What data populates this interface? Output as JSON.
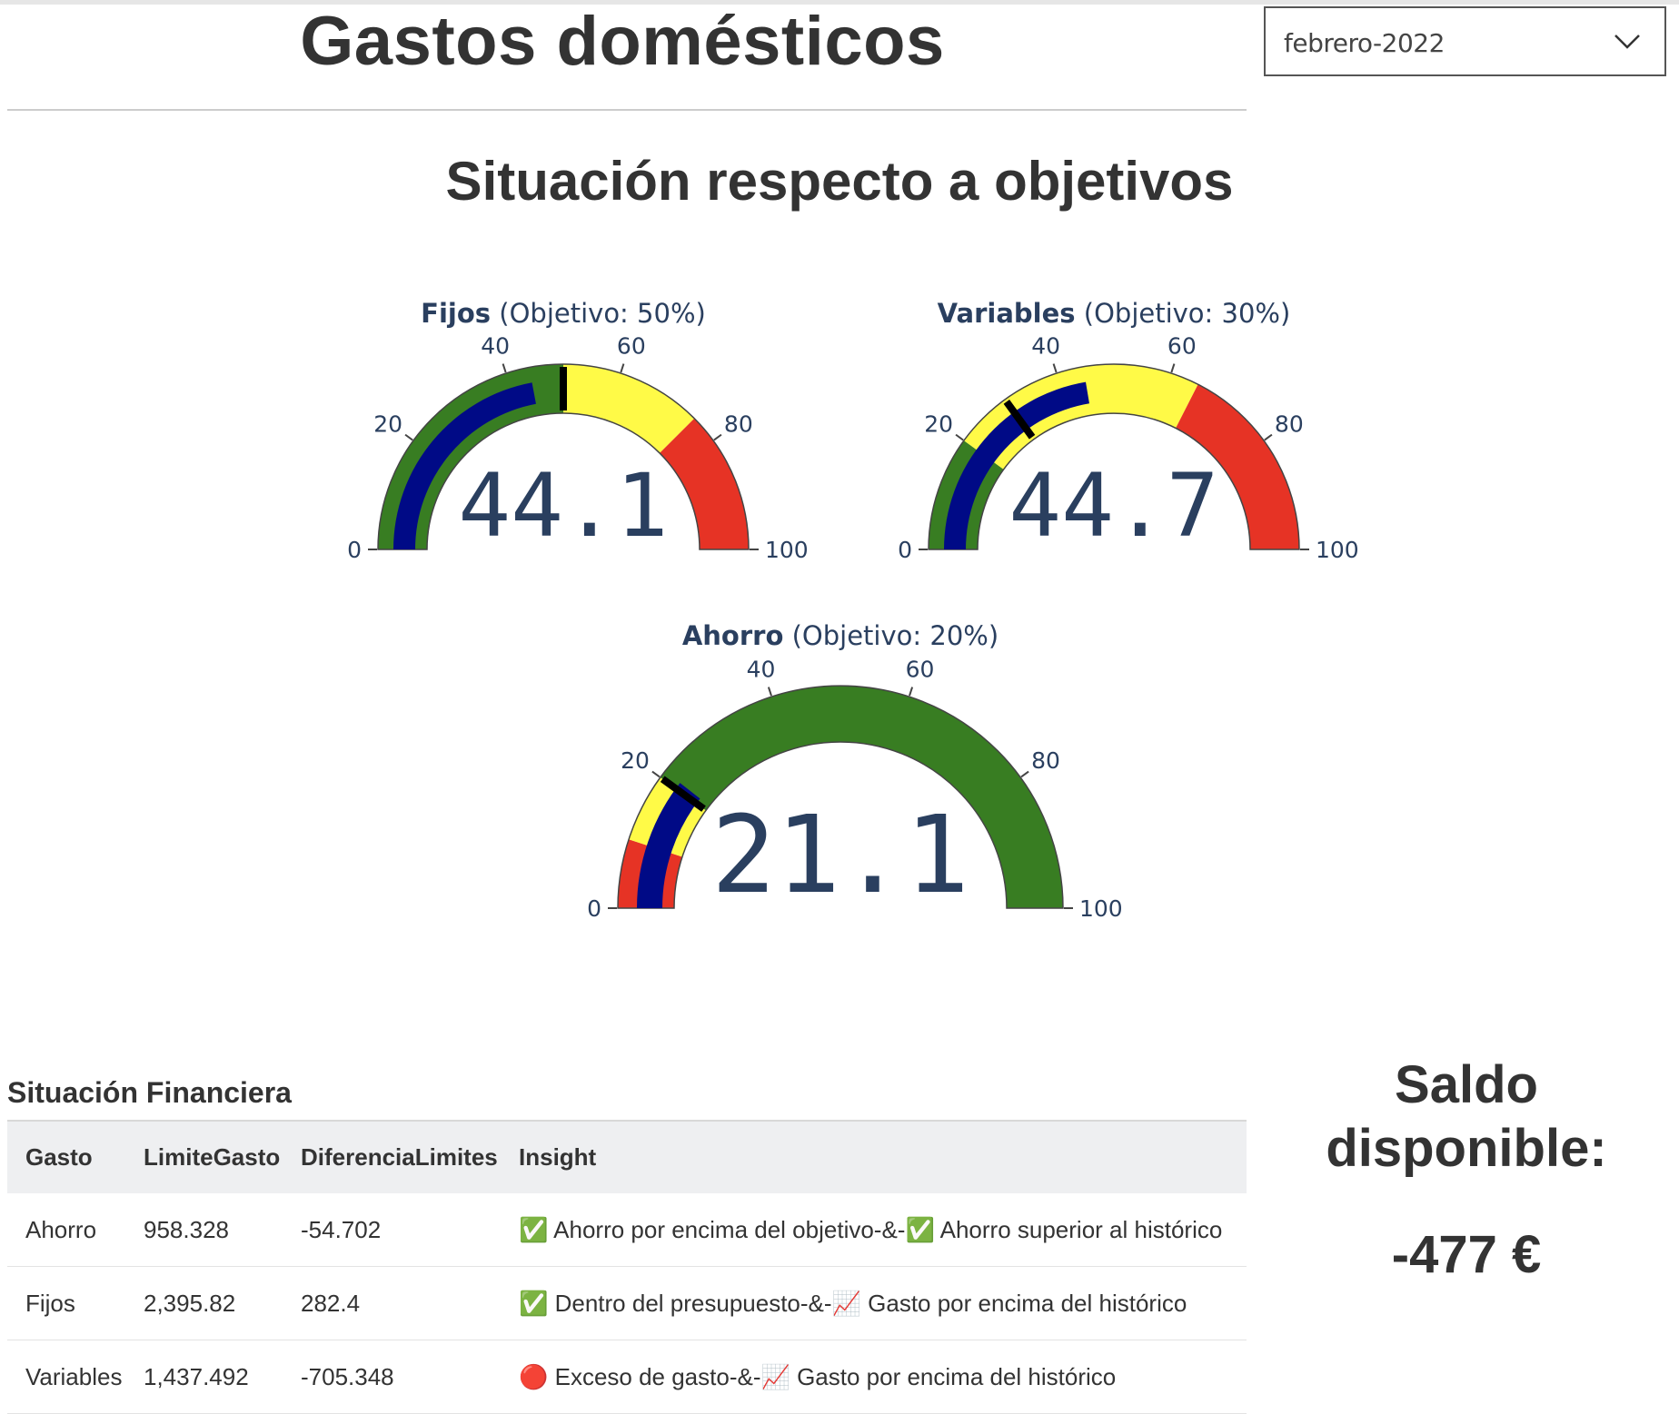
{
  "header": {
    "title": "Gastos domésticos",
    "month_select": {
      "value": "febrero-2022"
    }
  },
  "section_title": "Situación respecto a objetivos",
  "colors": {
    "green": "#387d22",
    "yellow": "#fffa47",
    "red": "#e63325",
    "bar": "#000a86",
    "text": "#2a3f5f"
  },
  "chart_data": [
    {
      "type": "gauge",
      "name": "Fijos",
      "title_suffix": " (Objetivo: 50%)",
      "value": 44.1,
      "threshold": 50,
      "range": [
        0,
        100
      ],
      "tick_labels": [
        "0",
        "20",
        "40",
        "60",
        "80",
        "100"
      ],
      "steps": [
        {
          "range": [
            0,
            50
          ],
          "color": "green"
        },
        {
          "range": [
            50,
            75
          ],
          "color": "yellow"
        },
        {
          "range": [
            75,
            100
          ],
          "color": "red"
        }
      ]
    },
    {
      "type": "gauge",
      "name": "Variables",
      "title_suffix": " (Objetivo: 30%)",
      "value": 44.7,
      "threshold": 30,
      "range": [
        0,
        100
      ],
      "tick_labels": [
        "0",
        "20",
        "40",
        "60",
        "80",
        "100"
      ],
      "steps": [
        {
          "range": [
            0,
            20
          ],
          "color": "green"
        },
        {
          "range": [
            20,
            65
          ],
          "color": "yellow"
        },
        {
          "range": [
            65,
            100
          ],
          "color": "red"
        }
      ]
    },
    {
      "type": "gauge",
      "name": "Ahorro",
      "title_suffix": " (Objetivo: 20%)",
      "value": 21.1,
      "threshold": 20,
      "range": [
        0,
        100
      ],
      "tick_labels": [
        "0",
        "20",
        "40",
        "60",
        "80",
        "100"
      ],
      "steps": [
        {
          "range": [
            0,
            10
          ],
          "color": "red"
        },
        {
          "range": [
            10,
            20
          ],
          "color": "yellow"
        },
        {
          "range": [
            20,
            100
          ],
          "color": "green"
        }
      ]
    }
  ],
  "financial": {
    "title": "Situación Financiera",
    "columns": [
      "Gasto",
      "LimiteGasto",
      "DiferenciaLimites",
      "Insight"
    ],
    "rows": [
      [
        "Ahorro",
        "958.328",
        "-54.702",
        "✅ Ahorro por encima del objetivo-&-✅ Ahorro superior al histórico"
      ],
      [
        "Fijos",
        "2,395.82",
        "282.4",
        "✅ Dentro del presupuesto-&-📈 Gasto por encima del histórico"
      ],
      [
        "Variables",
        "1,437.492",
        "-705.348",
        "🔴 Exceso de gasto-&-📈 Gasto por encima del histórico"
      ]
    ]
  },
  "saldo": {
    "title": "Saldo disponible:",
    "value": "-477 €"
  }
}
